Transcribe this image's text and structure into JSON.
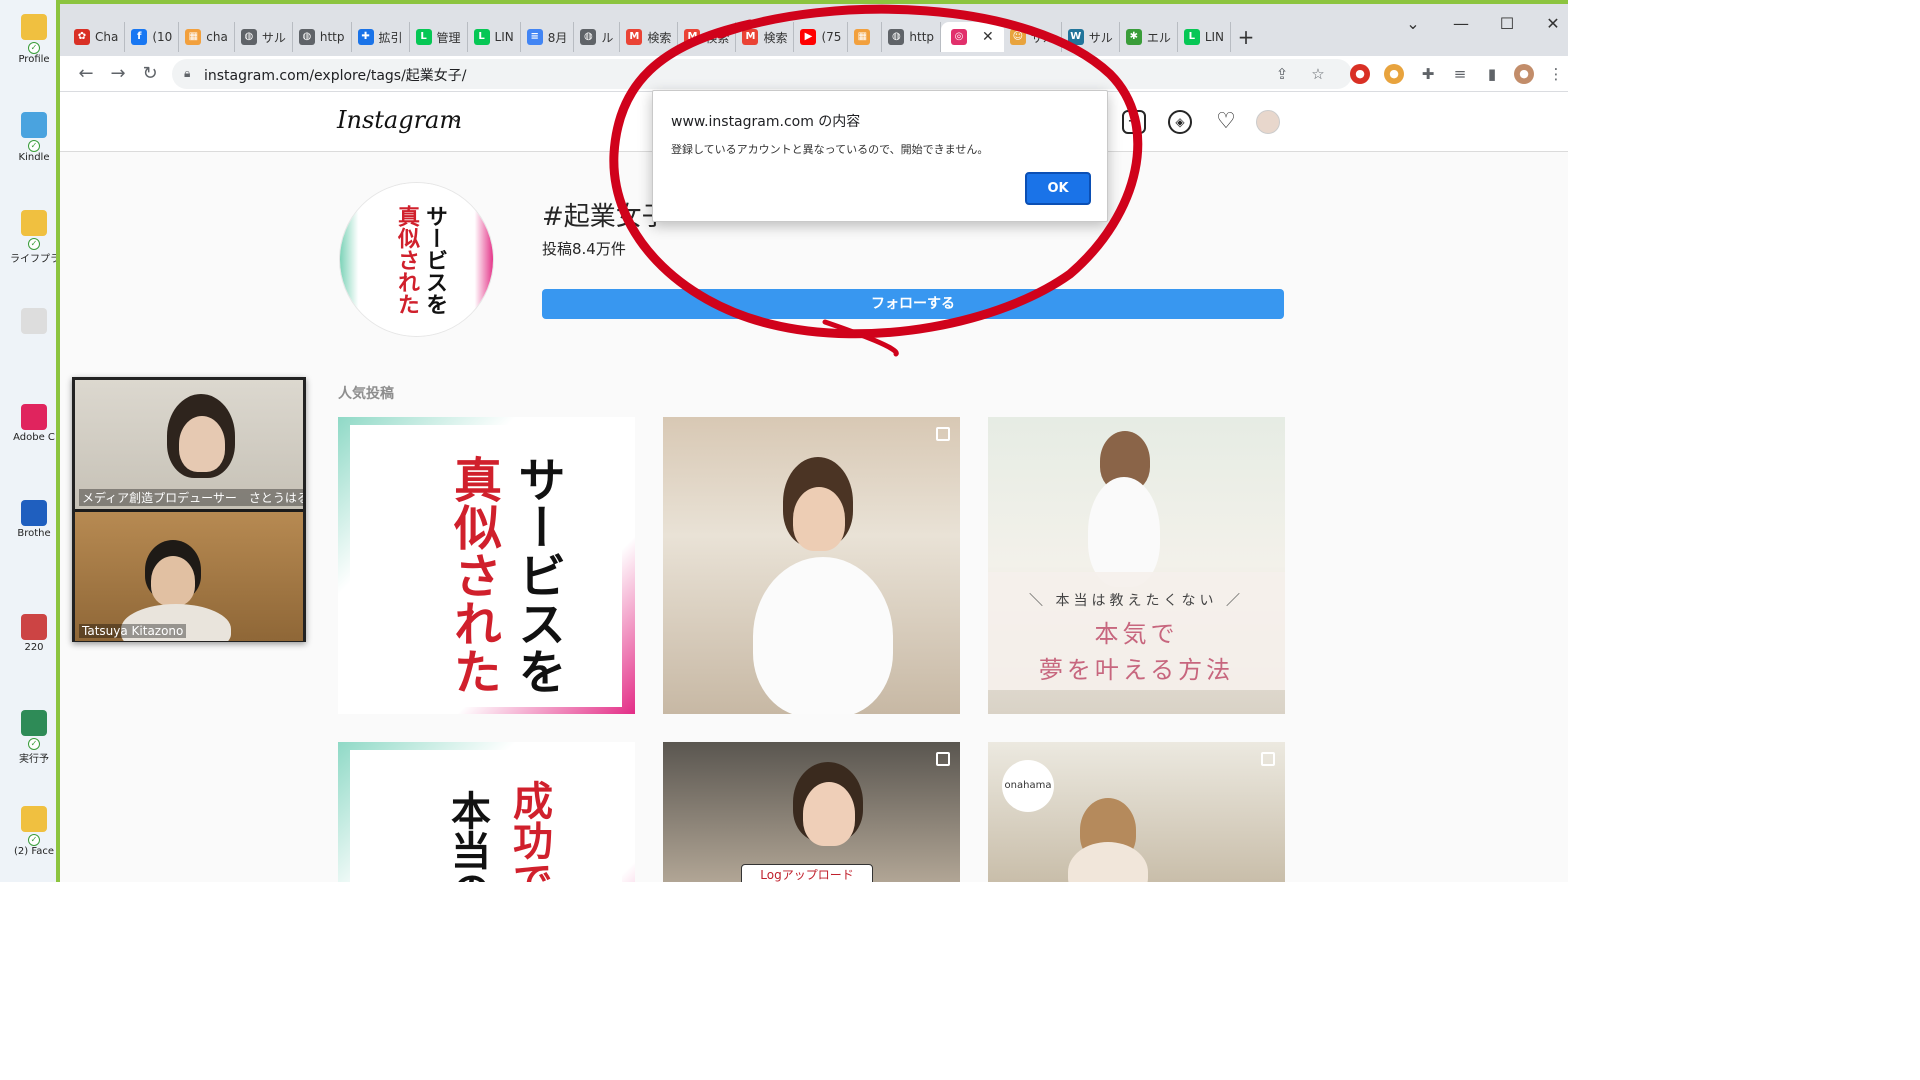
{
  "desktop": {
    "icons": [
      {
        "label": "Profile",
        "color": "#f0c040"
      },
      {
        "label": "Kindle",
        "color": "#4aa3df"
      },
      {
        "label": "ライフプラン成 調査",
        "color": "#f0c040"
      },
      {
        "label": "",
        "color": "#dddddd"
      },
      {
        "label": "Adobe C",
        "color": "#e0245e"
      },
      {
        "label": "Brothe",
        "color": "#1f5fbf"
      },
      {
        "label": "220",
        "color": "#cc4444"
      },
      {
        "label": "実行予",
        "color": "#2e8b57"
      },
      {
        "label": "(2) Face",
        "color": "#f0c040"
      }
    ]
  },
  "browser": {
    "tabs": [
      {
        "label": "Cha",
        "icon": "flower-icon",
        "color": "#d93025"
      },
      {
        "label": "(10",
        "icon": "facebook-icon",
        "color": "#1877f2"
      },
      {
        "label": "cha",
        "icon": "grid-icon",
        "color": "#f2a03d"
      },
      {
        "label": "サル",
        "icon": "globe-icon",
        "color": "#5f6368"
      },
      {
        "label": "http",
        "icon": "globe-icon",
        "color": "#5f6368"
      },
      {
        "label": "拡引",
        "icon": "puzzle-icon",
        "color": "#1a73e8"
      },
      {
        "label": "管理",
        "icon": "line-icon",
        "color": "#06c755"
      },
      {
        "label": "LIN",
        "icon": "line-icon",
        "color": "#06c755"
      },
      {
        "label": "8月",
        "icon": "docs-icon",
        "color": "#4285f4"
      },
      {
        "label": "ル",
        "icon": "globe-icon",
        "color": "#5f6368"
      },
      {
        "label": "検索",
        "icon": "gmail-icon",
        "color": "#ea4335"
      },
      {
        "label": "検索",
        "icon": "gmail-icon",
        "color": "#ea4335"
      },
      {
        "label": "検索",
        "icon": "gmail-icon",
        "color": "#ea4335"
      },
      {
        "label": "(75",
        "icon": "youtube-icon",
        "color": "#ff0000"
      },
      {
        "label": "",
        "icon": "grid-icon",
        "color": "#f2a03d"
      },
      {
        "label": "http",
        "icon": "globe-icon",
        "color": "#5f6368"
      }
    ],
    "active_tab": {
      "label": "",
      "icon": "instagram-icon",
      "color": "#e1306c"
    },
    "tabs_after": [
      {
        "label": "サル",
        "icon": "monkey-icon",
        "color": "#e8a33d"
      },
      {
        "label": "サル",
        "icon": "wordpress-icon",
        "color": "#21759b"
      },
      {
        "label": "エル",
        "icon": "bug-icon",
        "color": "#3a9d3a"
      },
      {
        "label": "LIN",
        "icon": "line-icon",
        "color": "#06c755"
      }
    ],
    "new_tab_label": "+",
    "url": "instagram.com/explore/tags/起業女子/"
  },
  "instagram": {
    "logo": "Instagram",
    "tag_title": "#起業女子",
    "posts_count": "投稿8.4万件",
    "follow_label": "フォローする",
    "popular_label": "人気投稿",
    "avatar_text_right": "サービスを",
    "avatar_text_left": "真似された",
    "post1_right": "サービスを",
    "post1_left": "真似された",
    "post3_sub": "＼ 本当は教えたくない ／",
    "post3_main1": "本気で",
    "post3_main2": "夢を叶える方法",
    "post4_right": "成功で",
    "post4_left": "本当の",
    "post5_label": "Logアップロード",
    "post6_badge": "onahama"
  },
  "videocall": {
    "participants": [
      {
        "name": "メディア創造プロデューサー　さとうはるよ"
      },
      {
        "name": "Tatsuya Kitazono"
      }
    ]
  },
  "dialog": {
    "title": "www.instagram.com の内容",
    "message": "登録しているアカウントと異なっているので、開始できません。",
    "ok_label": "OK"
  },
  "colors": {
    "annotation": "#d0021b",
    "follow": "#3897f0",
    "window_border": "#8cc43f"
  }
}
